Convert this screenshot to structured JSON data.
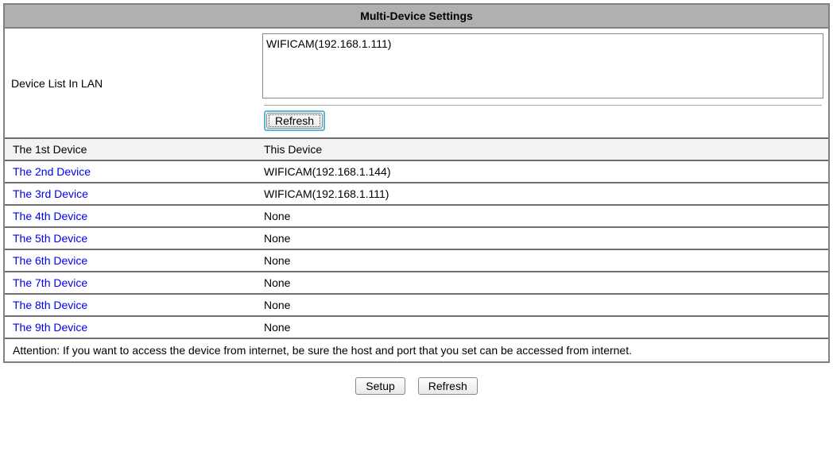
{
  "title": "Multi-Device Settings",
  "lan": {
    "label": "Device List In LAN",
    "items": [
      "WIFICAM(192.168.1.111)"
    ],
    "refresh_label": "Refresh"
  },
  "devices": [
    {
      "label": "The 1st Device",
      "value": "This Device",
      "link": false,
      "light": true
    },
    {
      "label": "The 2nd Device",
      "value": "WIFICAM(192.168.1.144)",
      "link": true,
      "light": false
    },
    {
      "label": "The 3rd Device",
      "value": "WIFICAM(192.168.1.111)",
      "link": true,
      "light": false
    },
    {
      "label": "The 4th Device",
      "value": "None",
      "link": true,
      "light": false
    },
    {
      "label": "The 5th Device",
      "value": "None",
      "link": true,
      "light": false
    },
    {
      "label": "The 6th Device",
      "value": "None",
      "link": true,
      "light": false
    },
    {
      "label": "The 7th Device",
      "value": "None",
      "link": true,
      "light": false
    },
    {
      "label": "The 8th Device",
      "value": "None",
      "link": true,
      "light": false
    },
    {
      "label": "The 9th Device",
      "value": "None",
      "link": true,
      "light": false
    }
  ],
  "attention": "Attention: If you want to access the device from internet, be sure the host and port that you set can be accessed from internet.",
  "buttons": {
    "setup": "Setup",
    "refresh": "Refresh"
  }
}
